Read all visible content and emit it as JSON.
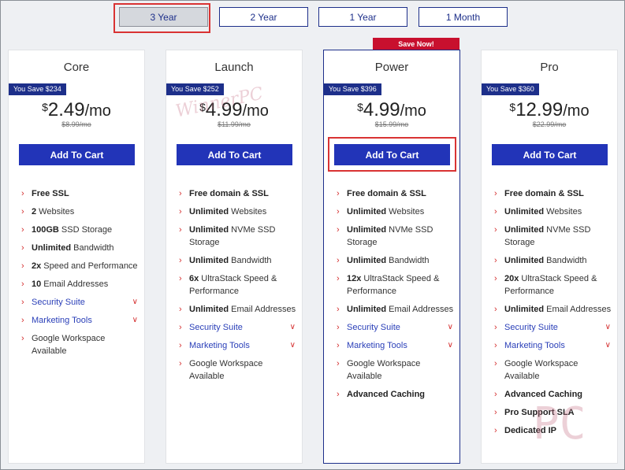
{
  "terms": [
    {
      "label": "3 Year",
      "active": true
    },
    {
      "label": "2 Year",
      "active": false
    },
    {
      "label": "1 Year",
      "active": false
    },
    {
      "label": "1 Month",
      "active": false
    }
  ],
  "save_now_badge": "Save Now!",
  "plans": [
    {
      "name": "Core",
      "savings": "You Save $234",
      "currency": "$",
      "amount": "2.49",
      "period": "/mo",
      "old_price": "$8.99/mo",
      "cta": "Add To Cart",
      "features": [
        {
          "bold": "Free SSL",
          "text": ""
        },
        {
          "bold": "2",
          "text": " Websites"
        },
        {
          "bold": "100GB",
          "text": " SSD Storage"
        },
        {
          "bold": "Unlimited",
          "text": " Bandwidth"
        },
        {
          "bold": "2x",
          "text": " Speed and Performance"
        },
        {
          "bold": "10",
          "text": " Email Addresses"
        },
        {
          "link": "Security Suite"
        },
        {
          "link": "Marketing Tools"
        },
        {
          "bold": "",
          "text": "Google Workspace Available"
        }
      ]
    },
    {
      "name": "Launch",
      "savings": "You Save $252",
      "currency": "$",
      "amount": "4.99",
      "period": "/mo",
      "old_price": "$11.99/mo",
      "cta": "Add To Cart",
      "features": [
        {
          "bold": "Free domain & SSL",
          "text": ""
        },
        {
          "bold": "Unlimited",
          "text": " Websites"
        },
        {
          "bold": "Unlimited",
          "text": " NVMe SSD Storage"
        },
        {
          "bold": "Unlimited",
          "text": " Bandwidth"
        },
        {
          "bold": "6x",
          "text": " UltraStack Speed & Performance"
        },
        {
          "bold": "Unlimited",
          "text": " Email Addresses"
        },
        {
          "link": "Security Suite"
        },
        {
          "link": "Marketing Tools"
        },
        {
          "bold": "",
          "text": "Google Workspace Available"
        }
      ]
    },
    {
      "name": "Power",
      "savings": "You Save $396",
      "currency": "$",
      "amount": "4.99",
      "period": "/mo",
      "old_price": "$15.99/mo",
      "cta": "Add To Cart",
      "features": [
        {
          "bold": "Free domain & SSL",
          "text": ""
        },
        {
          "bold": "Unlimited",
          "text": " Websites"
        },
        {
          "bold": "Unlimited",
          "text": " NVMe SSD Storage"
        },
        {
          "bold": "Unlimited",
          "text": " Bandwidth"
        },
        {
          "bold": "12x",
          "text": " UltraStack Speed & Performance"
        },
        {
          "bold": "Unlimited",
          "text": " Email Addresses"
        },
        {
          "link": "Security Suite"
        },
        {
          "link": "Marketing Tools"
        },
        {
          "bold": "",
          "text": "Google Workspace Available"
        },
        {
          "bold": "Advanced Caching",
          "text": ""
        }
      ]
    },
    {
      "name": "Pro",
      "savings": "You Save $360",
      "currency": "$",
      "amount": "12.99",
      "period": "/mo",
      "old_price": "$22.99/mo",
      "cta": "Add To Cart",
      "features": [
        {
          "bold": "Free domain & SSL",
          "text": ""
        },
        {
          "bold": "Unlimited",
          "text": " Websites"
        },
        {
          "bold": "Unlimited",
          "text": " NVMe SSD Storage"
        },
        {
          "bold": "Unlimited",
          "text": " Bandwidth"
        },
        {
          "bold": "20x",
          "text": " UltraStack Speed & Performance"
        },
        {
          "bold": "Unlimited",
          "text": " Email Addresses"
        },
        {
          "link": "Security Suite"
        },
        {
          "link": "Marketing Tools"
        },
        {
          "bold": "",
          "text": "Google Workspace Available"
        },
        {
          "bold": "Advanced Caching",
          "text": ""
        },
        {
          "bold": "Pro Support SLA",
          "text": ""
        },
        {
          "bold": "Dedicated IP",
          "text": ""
        }
      ]
    }
  ],
  "icons": {
    "bullet": "arrow-right-icon",
    "expand": "chevron-down-icon"
  },
  "colors": {
    "brand": "#1d2f8a",
    "button": "#2234b8",
    "accent": "#d53030",
    "badge": "#c8102e"
  },
  "watermark_text": "WinnerPC"
}
